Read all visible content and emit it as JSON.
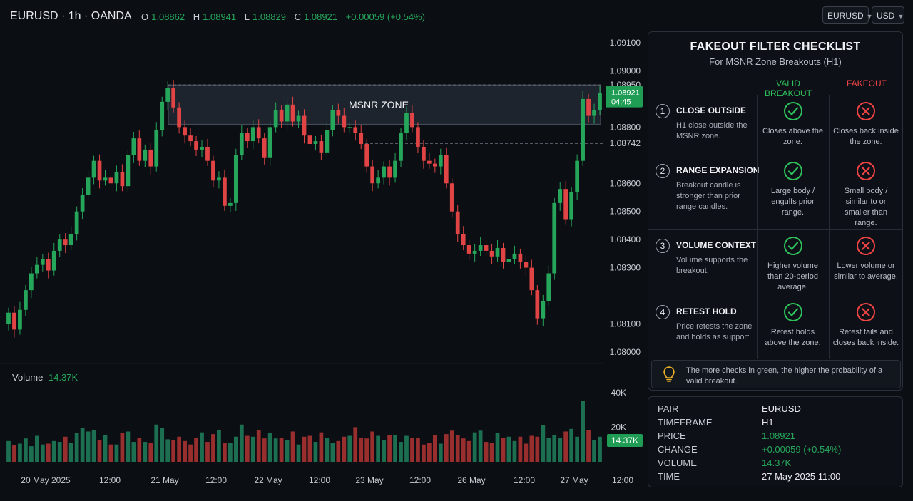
{
  "header": {
    "symbol": "EURUSD · 1h · OANDA",
    "ohlc": [
      {
        "k": "O",
        "v": "1.08862"
      },
      {
        "k": "H",
        "v": "1.08941"
      },
      {
        "k": "L",
        "v": "1.08829"
      },
      {
        "k": "C",
        "v": "1.08921"
      }
    ],
    "change": "+0.00059 (+0.54%)",
    "pair_select": "EURUSD",
    "currency_select": "USD"
  },
  "colors": {
    "up": "#26a65b",
    "down": "#e04444",
    "background": "#0b0e13",
    "zone": "#2f3744"
  },
  "chart_data": {
    "type": "candlestick",
    "title": "EURUSD · 1h · OANDA",
    "price_ticks": [
      "1.09100",
      "1.09000",
      "1.08950",
      "1.08800",
      "1.08742",
      "1.08600",
      "1.08500",
      "1.08400",
      "1.08300",
      "1.08100",
      "1.08000"
    ],
    "price_tick_values": [
      1.091,
      1.09,
      1.0895,
      1.088,
      1.08742,
      1.086,
      1.085,
      1.084,
      1.083,
      1.081,
      1.08
    ],
    "time_labels": [
      "20 May 2025",
      "12:00",
      "21 May",
      "12:00",
      "22 May",
      "12:00",
      "23 May",
      "12:00",
      "26 May",
      "12:00",
      "27 May",
      "12:00"
    ],
    "zone": {
      "label": "MSNR ZONE",
      "low": 1.0881,
      "high": 1.0895
    },
    "levels": [
      1.0895,
      1.08742
    ],
    "last_price": "1.08921",
    "countdown": "04:45",
    "volume_label": "Volume",
    "volume_value": "14.37K",
    "volume_ticks": [
      "40K",
      "20K"
    ],
    "volume_tick_values": [
      40000,
      20000
    ],
    "closes": [
      1.0814,
      1.0808,
      1.0815,
      1.0822,
      1.0828,
      1.0831,
      1.0833,
      1.0829,
      1.0836,
      1.084,
      1.0838,
      1.0842,
      1.085,
      1.0856,
      1.0862,
      1.0868,
      1.0861,
      1.0862,
      1.086,
      1.0864,
      1.0859,
      1.087,
      1.0876,
      1.0868,
      1.0872,
      1.0866,
      1.0879,
      1.0889,
      1.0894,
      1.0887,
      1.088,
      1.0877,
      1.0875,
      1.0872,
      1.0873,
      1.0868,
      1.0861,
      1.0862,
      1.0852,
      1.0853,
      1.087,
      1.0878,
      1.0875,
      1.088,
      1.0876,
      1.0869,
      1.088,
      1.0886,
      1.0882,
      1.0888,
      1.0882,
      1.0884,
      1.0877,
      1.0874,
      1.0875,
      1.0871,
      1.0879,
      1.0886,
      1.0884,
      1.088,
      1.088,
      1.0878,
      1.0874,
      1.0866,
      1.086,
      1.0862,
      1.0866,
      1.0862,
      1.0868,
      1.0878,
      1.0885,
      1.088,
      1.0873,
      1.0868,
      1.0867,
      1.0866,
      1.087,
      1.086,
      1.085,
      1.0842,
      1.0838,
      1.0835,
      1.0836,
      1.0838,
      1.0836,
      1.0834,
      1.0837,
      1.0832,
      1.0833,
      1.0835,
      1.0832,
      1.083,
      1.0822,
      1.0812,
      1.0818,
      1.0828,
      1.0853,
      1.0858,
      1.0847,
      1.0857,
      1.0868,
      1.089,
      1.0884,
      1.0886,
      1.0892
    ],
    "volumes": [
      12000,
      9500,
      10500,
      13500,
      9000,
      15000,
      10000,
      10500,
      12000,
      11500,
      14500,
      11000,
      16500,
      19500,
      17500,
      18500,
      12500,
      15500,
      10000,
      10000,
      16500,
      17500,
      11500,
      14000,
      11500,
      11000,
      21500,
      19500,
      13000,
      12500,
      14500,
      12000,
      10000,
      14000,
      17000,
      11500,
      16000,
      18500,
      11000,
      11000,
      14500,
      21500,
      15000,
      14500,
      18500,
      13500,
      16500,
      13500,
      14000,
      12500,
      17500,
      10000,
      14500,
      15000,
      11500,
      17000,
      14000,
      11000,
      12000,
      14500,
      15000,
      20000,
      14000,
      13500,
      17500,
      15000,
      12500,
      15500,
      15500,
      11500,
      15000,
      14000,
      14000,
      10000,
      11000,
      15500,
      10500,
      16000,
      18000,
      15500,
      13500,
      12000,
      17000,
      18000,
      11500,
      11000,
      16500,
      14000,
      14500,
      12000,
      14500,
      10500,
      15000,
      14500,
      21000,
      14000,
      15500,
      14000,
      17500,
      19000,
      14500,
      35000,
      18500,
      12500,
      14500
    ]
  },
  "checklist": {
    "title": "FAKEOUT FILTER CHECKLIST",
    "subtitle": "For MSNR Zone Breakouts (H1)",
    "valid_header": "VALID BREAKOUT",
    "fake_header": "FAKEOUT",
    "rows": [
      {
        "num": "1",
        "title": "CLOSE OUTSIDE",
        "desc": "H1 close outside the MSNR zone.",
        "valid": "Closes above the zone.",
        "fake": "Closes back inside the zone."
      },
      {
        "num": "2",
        "title": "RANGE EXPANSION",
        "desc": "Breakout candle is stronger than prior range candles.",
        "valid": "Large body / engulfs prior range.",
        "fake": "Small body / similar to or smaller than range."
      },
      {
        "num": "3",
        "title": "VOLUME CONTEXT",
        "desc": "Volume supports the breakout.",
        "valid": "Higher volume than 20-period average.",
        "fake": "Lower volume or similar to average."
      },
      {
        "num": "4",
        "title": "RETEST HOLD",
        "desc": "Price retests the zone and holds as support.",
        "valid": "Retest holds above the zone.",
        "fake": "Retest fails and closes back inside."
      }
    ],
    "tip": "The more checks in green, the higher the probability of a valid breakout."
  },
  "info": {
    "pair_label": "PAIR",
    "pair": "EURUSD",
    "timeframe_label": "TIMEFRAME",
    "timeframe": "H1",
    "price_label": "PRICE",
    "price": "1.08921",
    "change_label": "CHANGE",
    "change": "+0.00059 (+0.54%)",
    "volume_label": "VOLUME",
    "volume": "14.37K",
    "time_label": "TIME",
    "time": "27 May 2025 11:00"
  }
}
